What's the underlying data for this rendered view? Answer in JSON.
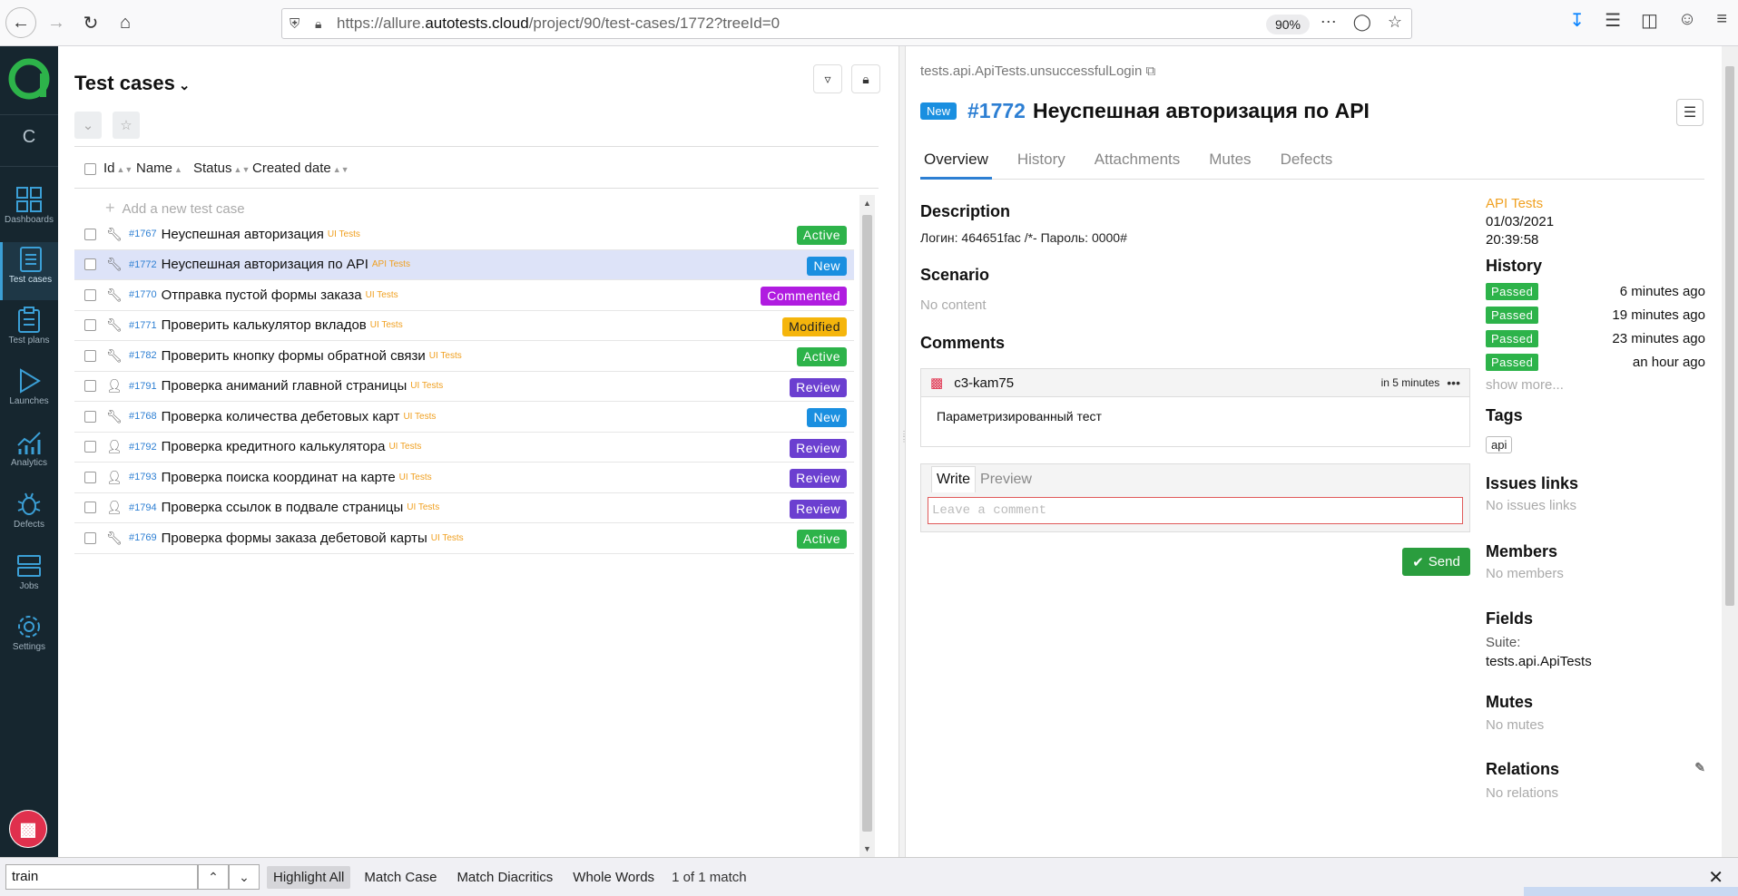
{
  "browser": {
    "url_pre": "https://allure.",
    "url_domain": "autotests.cloud",
    "url_post": "/project/90/test-cases/1772?treeId=0",
    "zoom": "90%"
  },
  "sidebar": {
    "c_label": "C",
    "items": [
      {
        "label": "Dashboards"
      },
      {
        "label": "Test cases"
      },
      {
        "label": "Test plans"
      },
      {
        "label": "Launches"
      },
      {
        "label": "Analytics"
      },
      {
        "label": "Defects"
      },
      {
        "label": "Jobs"
      },
      {
        "label": "Settings"
      }
    ]
  },
  "list": {
    "title": "Test cases",
    "columns": {
      "id": "Id",
      "name": "Name",
      "status": "Status",
      "created": "Created date"
    },
    "add_placeholder": "Add a new test case",
    "rows": [
      {
        "id": "#1767",
        "name": "Неуспешная авторизация",
        "tag": "UI Tests",
        "status": "Active",
        "icon": "wrench"
      },
      {
        "id": "#1772",
        "name": "Неуспешная авторизация по API",
        "tag": "API Tests",
        "status": "New",
        "icon": "wrench"
      },
      {
        "id": "#1770",
        "name": "Отправка пустой формы заказа",
        "tag": "UI Tests",
        "status": "Commented",
        "icon": "wrench"
      },
      {
        "id": "#1771",
        "name": "Проверить калькулятор вкладов",
        "tag": "UI Tests",
        "status": "Modified",
        "icon": "wrench"
      },
      {
        "id": "#1782",
        "name": "Проверить кнопку формы обратной связи",
        "tag": "UI Tests",
        "status": "Active",
        "icon": "wrench"
      },
      {
        "id": "#1791",
        "name": "Проверка аниманий главной страницы",
        "tag": "UI Tests",
        "status": "Review",
        "icon": "person"
      },
      {
        "id": "#1768",
        "name": "Проверка количества дебетовых карт",
        "tag": "UI Tests",
        "status": "New",
        "icon": "wrench"
      },
      {
        "id": "#1792",
        "name": "Проверка кредитного калькулятора",
        "tag": "UI Tests",
        "status": "Review",
        "icon": "person"
      },
      {
        "id": "#1793",
        "name": "Проверка поиска координат на карте",
        "tag": "UI Tests",
        "status": "Review",
        "icon": "person"
      },
      {
        "id": "#1794",
        "name": "Проверка ссылок в подвале страницы",
        "tag": "UI Tests",
        "status": "Review",
        "icon": "person"
      },
      {
        "id": "#1769",
        "name": "Проверка формы заказа дебетовой карты",
        "tag": "UI Tests",
        "status": "Active",
        "icon": "wrench"
      }
    ]
  },
  "detail": {
    "crumb": "tests.api.ApiTests.unsuccessfulLogin",
    "status": "New",
    "id": "#1772",
    "name": "Неуспешная авторизация по API",
    "tabs": [
      "Overview",
      "History",
      "Attachments",
      "Mutes",
      "Defects"
    ],
    "description_h": "Description",
    "description": "Логин: 464651fac /*- Пароль: 0000#",
    "scenario_h": "Scenario",
    "scenario": "No content",
    "comments_h": "Comments",
    "comment": {
      "user": "c3-kam75",
      "time": "in 5 minutes",
      "text": "Параметризированный тест"
    },
    "write_tab": "Write",
    "preview_tab": "Preview",
    "comment_placeholder": "Leave a comment",
    "send": "Send"
  },
  "side": {
    "suite_link": "API Tests",
    "date": "01/03/2021",
    "time": "20:39:58",
    "history_h": "History",
    "history": [
      {
        "status": "Passed",
        "time": "6 minutes ago"
      },
      {
        "status": "Passed",
        "time": "19 minutes ago"
      },
      {
        "status": "Passed",
        "time": "23 minutes ago"
      },
      {
        "status": "Passed",
        "time": "an hour ago"
      }
    ],
    "show_more": "show more...",
    "tags_h": "Tags",
    "tag": "api",
    "issues_h": "Issues links",
    "issues": "No issues links",
    "members_h": "Members",
    "members": "No members",
    "fields_h": "Fields",
    "fields_label": "Suite:",
    "fields_value": "tests.api.ApiTests",
    "mutes_h": "Mutes",
    "mutes": "No mutes",
    "relations_h": "Relations",
    "relations": "No relations"
  },
  "findbar": {
    "query": "train",
    "highlight_all": "Highlight All",
    "match_case": "Match Case",
    "match_diacritics": "Match Diacritics",
    "whole_words": "Whole Words",
    "status": "1 of 1 match"
  },
  "colors": {
    "accent": "#2d7fd3",
    "sidebar_bg": "#16262f",
    "active": "#2db34a",
    "new": "#1a8fe0",
    "commented": "#b01ce0",
    "modified": "#f5b50c",
    "review": "#6b3fd0"
  }
}
